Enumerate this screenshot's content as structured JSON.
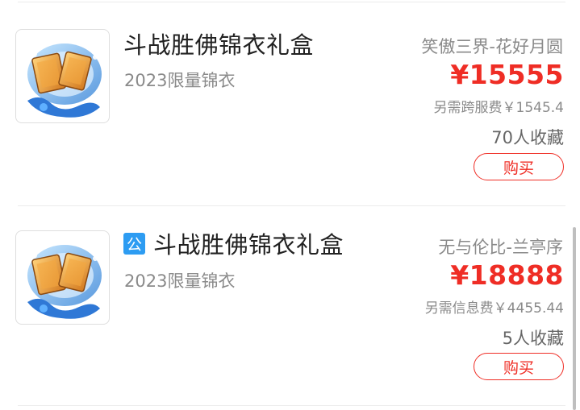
{
  "header": {
    "partial_title": ""
  },
  "items": [
    {
      "title": "斗战胜佛锦衣礼盒",
      "subtitle": "2023限量锦衣",
      "server": "笑傲三界-花好月圆",
      "price": "¥15555",
      "fee": "另需跨服费￥1545.4",
      "favorites": "70人收藏",
      "buy_label": "购买",
      "public_badge": ""
    },
    {
      "title": "斗战胜佛锦衣礼盒",
      "subtitle": "2023限量锦衣",
      "server": "无与伦比-兰亭序",
      "price": "¥18888",
      "fee": "另需信息费￥4455.44",
      "favorites": "5人收藏",
      "buy_label": "购买",
      "public_badge": "公"
    }
  ],
  "colors": {
    "price_red": "#ef2d25",
    "badge_blue": "#2d9cf2",
    "muted_text": "#8a8a8a"
  },
  "icons": {
    "thumbnail": "gift-box-icon",
    "badge": "public-badge-icon"
  }
}
